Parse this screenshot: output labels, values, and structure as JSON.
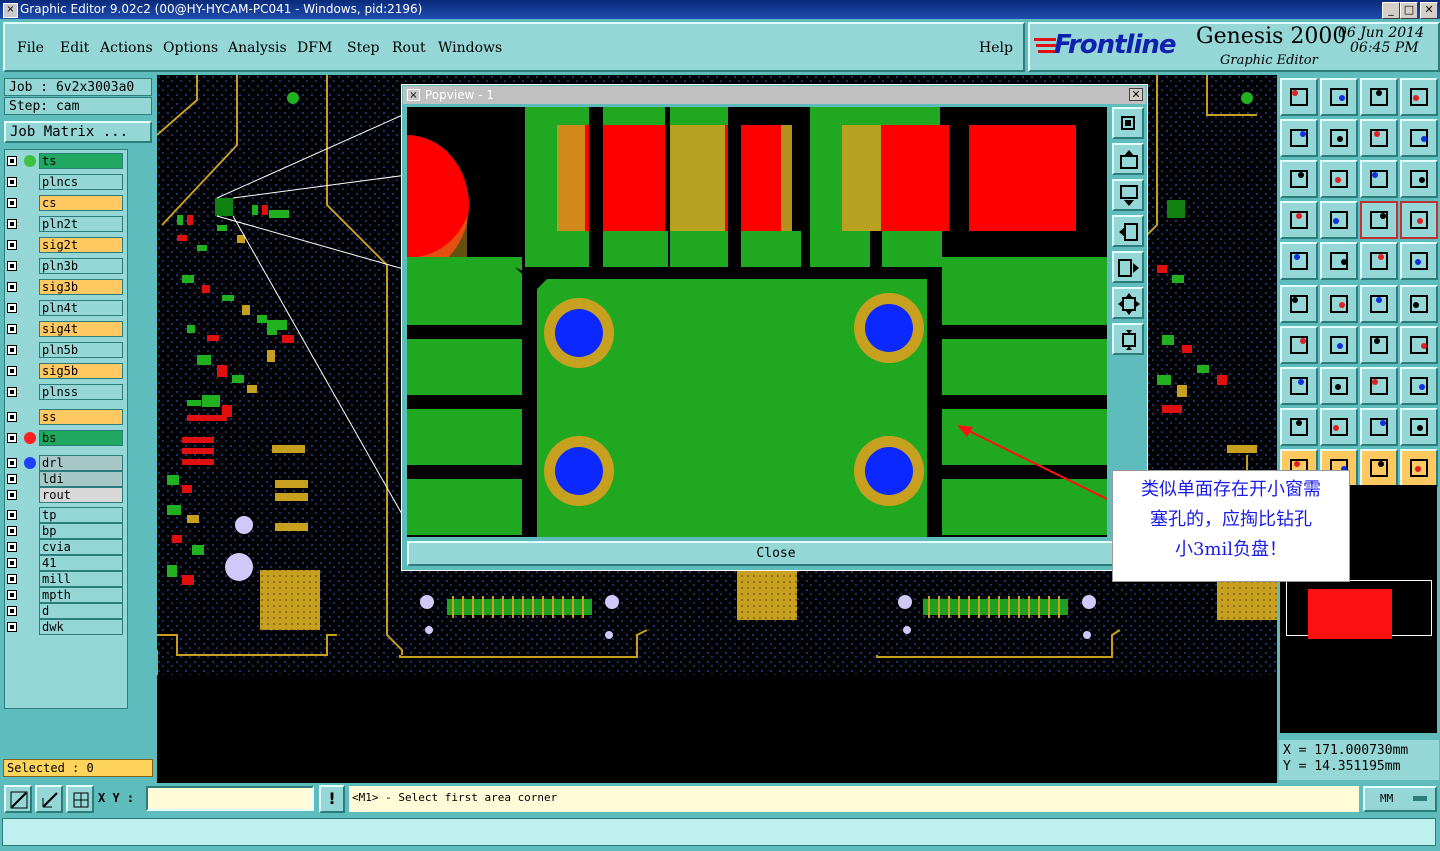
{
  "window": {
    "title": "Graphic Editor 9.02c2 (00@HY-HYCAM-PC041 - Windows, pid:2196)",
    "controls": [
      "_",
      "□",
      "✕"
    ]
  },
  "menu": {
    "items": [
      {
        "label": "File"
      },
      {
        "label": "Edit"
      },
      {
        "label": "Actions"
      },
      {
        "label": "Options"
      },
      {
        "label": "Analysis"
      },
      {
        "label": "DFM"
      },
      {
        "label": "Step"
      },
      {
        "label": "Rout"
      },
      {
        "label": "Windows"
      }
    ],
    "help": "Help"
  },
  "brand": {
    "logo": "Frontline",
    "product": "Genesis 2000",
    "subtitle": "Graphic Editor",
    "date": "06 Jun 2014",
    "time": "06:45 PM"
  },
  "job": {
    "job_label": "Job : 6v2x3003a0",
    "step_label": "Step: cam",
    "matrix_button": "Job Matrix ..."
  },
  "layers": [
    {
      "name": "ts",
      "color": "#20a860",
      "dot": "#40c040"
    },
    {
      "name": "plncs",
      "color": "#95d6d6"
    },
    {
      "name": "cs",
      "color": "#ffc860"
    },
    {
      "name": "pln2t",
      "color": "#95d6d6"
    },
    {
      "name": "sig2t",
      "color": "#ffc860"
    },
    {
      "name": "pln3b",
      "color": "#95d6d6"
    },
    {
      "name": "sig3b",
      "color": "#ffc860"
    },
    {
      "name": "pln4t",
      "color": "#95d6d6"
    },
    {
      "name": "sig4t",
      "color": "#ffc860"
    },
    {
      "name": "pln5b",
      "color": "#95d6d6"
    },
    {
      "name": "sig5b",
      "color": "#ffc860"
    },
    {
      "name": "plnss",
      "color": "#95d6d6"
    },
    {
      "name": "ss",
      "color": "#ffc860"
    },
    {
      "name": "bs",
      "color": "#20a860",
      "dot": "#ff2020"
    },
    {
      "name": "drl",
      "color": "#a8c8c8",
      "dot": "#2040ff"
    },
    {
      "name": "ldi",
      "color": "#a8c8c8"
    },
    {
      "name": "rout",
      "color": "#d8d8d8"
    },
    {
      "name": "tp",
      "color": "#95d6d6"
    },
    {
      "name": "bp",
      "color": "#95d6d6"
    },
    {
      "name": "cvia",
      "color": "#95d6d6"
    },
    {
      "name": "41",
      "color": "#95d6d6"
    },
    {
      "name": "mill",
      "color": "#95d6d6"
    },
    {
      "name": "mpth",
      "color": "#95d6d6"
    },
    {
      "name": "d",
      "color": "#95d6d6"
    },
    {
      "name": "dwk",
      "color": "#95d6d6"
    }
  ],
  "selected": "Selected : 0",
  "popview": {
    "title": "Popview - 1",
    "close_label": "Close"
  },
  "annotation": {
    "lines": [
      "类似单面存在开小窗需",
      "塞孔的，应掏比钻孔",
      "小3mil负盘！"
    ]
  },
  "coords": {
    "x": "X = 171.000730mm",
    "y": "Y = 14.351195mm"
  },
  "statusbar": {
    "xy_label": "X Y :",
    "xy_value": "",
    "message": "<M1> - Select first area corner",
    "units": "MM",
    "excl": "!"
  },
  "colors": {
    "accent": "#5fbcbc",
    "copper": "#20a820",
    "pad": "#ff0000",
    "drill": "#0a28ff",
    "ring": "#c8a020"
  }
}
